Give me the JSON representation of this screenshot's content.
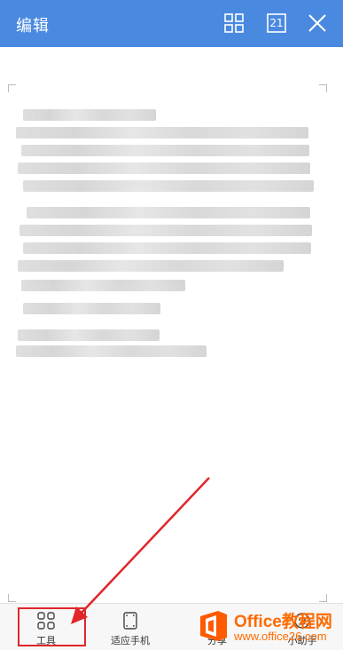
{
  "header": {
    "title": "编辑",
    "page_number": "21"
  },
  "bottom_bar": {
    "tools_label": "工具",
    "fit_label": "适应手机",
    "share_label": "分享",
    "helper_label": "小助手"
  },
  "watermark": {
    "brand": "Office教程网",
    "url": "www.office26.com"
  },
  "colors": {
    "header_bg": "#4a89e0",
    "highlight": "#e0262b",
    "watermark": "#ff6a00"
  }
}
